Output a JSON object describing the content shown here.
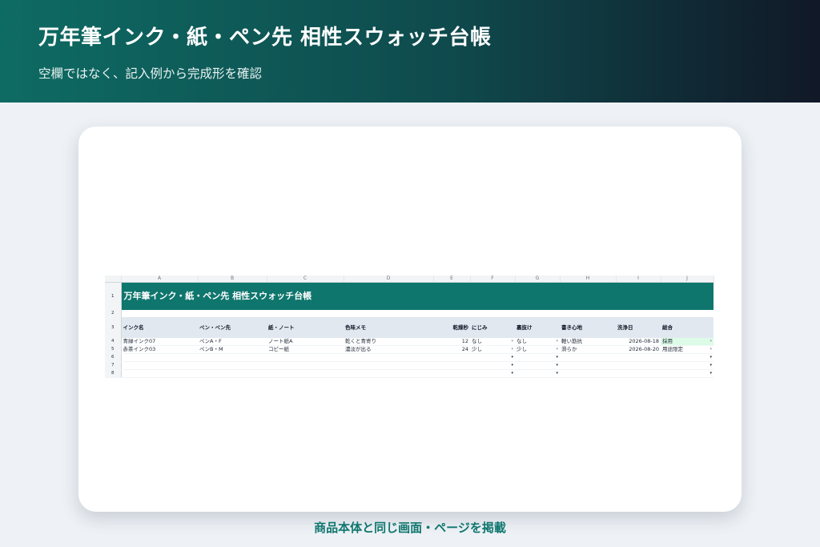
{
  "banner": {
    "title": "万年筆インク・紙・ペン先 相性スウォッチ台帳",
    "subtitle": "空欄ではなく、記入例から完成形を確認"
  },
  "caption": "商品本体と同じ画面・ページを掲載",
  "sheet": {
    "columns": [
      "A",
      "B",
      "C",
      "D",
      "E",
      "F",
      "G",
      "H",
      "I",
      "J"
    ],
    "row_numbers": [
      "1",
      "2",
      "3",
      "4",
      "5",
      "6",
      "7",
      "8"
    ],
    "title": "万年筆インク・紙・ペン先 相性スウォッチ台帳",
    "headers": [
      "インク名",
      "ペン・ペン先",
      "紙・ノート",
      "色味メモ",
      "乾燥秒",
      "にじみ",
      "裏抜け",
      "書き心地",
      "洗浄日",
      "総合"
    ],
    "rows": [
      {
        "ink": "青緑インク07",
        "pen": "ペンA・F",
        "paper": "ノート紙A",
        "color_memo": "乾くと青寄り",
        "dry_seconds": "12",
        "bleed": "なし",
        "showthrough": "なし",
        "feel": "軽い筋抗",
        "wash_date": "2026-08-18",
        "overall": "採用"
      },
      {
        "ink": "赤茶インク03",
        "pen": "ペンB・M",
        "paper": "コピー紙",
        "color_memo": "濃淡が出る",
        "dry_seconds": "24",
        "bleed": "少し",
        "showthrough": "少し",
        "feel": "滑らか",
        "wash_date": "2026-08-20",
        "overall": "用途限定"
      }
    ],
    "dropdown_glyph": "▾",
    "colors": {
      "title_bg": "#0f766e",
      "header_bg": "#e2e8f0",
      "adopt_bg": "#dcfce7"
    }
  }
}
